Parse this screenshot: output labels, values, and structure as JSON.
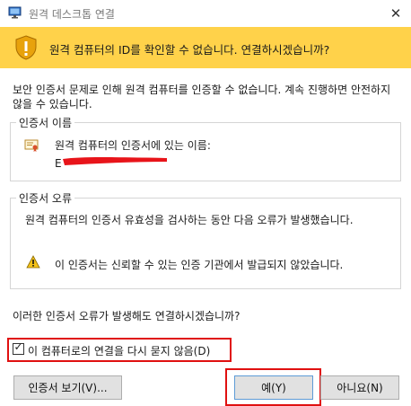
{
  "window": {
    "title": "원격 데스크톱 연결",
    "close_glyph": "✕"
  },
  "banner": {
    "text": "원격 컴퓨터의 ID를 확인할 수 없습니다. 연결하시겠습니까?",
    "color": "#ffd24a"
  },
  "intro": "보안 인증서 문제로 인해 원격 컴퓨터를 인증할 수 없습니다. 계속 진행하면 안전하지 않을 수 있습니다.",
  "cert_name_group": {
    "title": "인증서 이름",
    "label": "원격 컴퓨터의 인증서에 있는 이름:",
    "value": "E"
  },
  "cert_error_group": {
    "title": "인증서 오류",
    "description": "원격 컴퓨터의 인증서 유효성을 검사하는 동안 다음 오류가 발생했습니다.",
    "warning": "이 인증서는 신뢰할 수 있는 인증 기관에서 발급되지 않았습니다."
  },
  "question": "이러한 인증서 오류가 발생해도 연결하시겠습니까?",
  "checkbox": {
    "label": "이 컴퓨터로의 연결을 다시 묻지 않음(D)",
    "checked": true,
    "mark": "✓"
  },
  "buttons": {
    "view_cert": "인증서 보기(V)...",
    "yes": "예(Y)",
    "no": "아니요(N)"
  },
  "highlight_color": "#e01010"
}
